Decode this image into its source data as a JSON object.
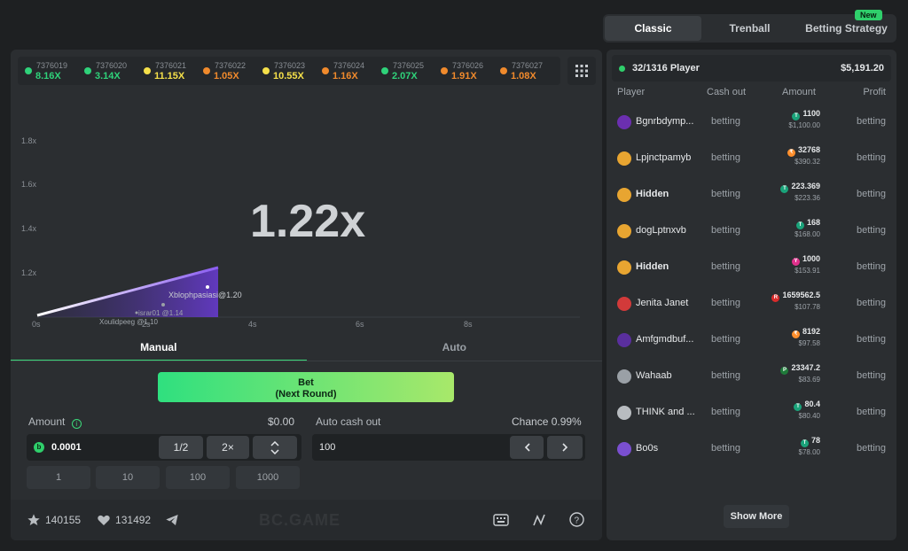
{
  "history": [
    {
      "id": "7376019",
      "mult": "8.16X",
      "color": "#2fd27a"
    },
    {
      "id": "7376020",
      "mult": "3.14X",
      "color": "#2fd27a"
    },
    {
      "id": "7376021",
      "mult": "11.15X",
      "color": "#f5e04a"
    },
    {
      "id": "7376022",
      "mult": "1.05X",
      "color": "#f08a2c"
    },
    {
      "id": "7376023",
      "mult": "10.55X",
      "color": "#f5e04a"
    },
    {
      "id": "7376024",
      "mult": "1.16X",
      "color": "#f08a2c"
    },
    {
      "id": "7376025",
      "mult": "2.07X",
      "color": "#2fd27a"
    },
    {
      "id": "7376026",
      "mult": "1.91X",
      "color": "#f08a2c"
    },
    {
      "id": "7376027",
      "mult": "1.08X",
      "color": "#f08a2c"
    }
  ],
  "game": {
    "multiplier": "1.22x",
    "y_ticks": [
      "1.8x",
      "1.6x",
      "1.4x",
      "1.2x"
    ],
    "x_ticks": [
      "0s",
      "4s",
      "6s",
      "8s"
    ],
    "x_tick_extra": "2s",
    "cashout_labels": [
      "Xblophpasiasi@1.20",
      "israr01 @1.14",
      "Xoulidpeeg @1.10"
    ]
  },
  "tabs": {
    "manual": "Manual",
    "auto": "Auto"
  },
  "bet_button": {
    "line1": "Bet",
    "line2": "(Next Round)"
  },
  "amount": {
    "label": "Amount",
    "usd": "$0.00",
    "value": "0.0001",
    "half": "1/2",
    "double": "2×",
    "quick": [
      "1",
      "10",
      "100",
      "1000"
    ]
  },
  "auto_cashout": {
    "label": "Auto cash out",
    "chance": "Chance 0.99%",
    "value": "100"
  },
  "footer": {
    "stars": "140155",
    "likes": "131492",
    "logo": "BC.GAME"
  },
  "top_tabs": {
    "classic": "Classic",
    "trenball": "Trenball",
    "strategy": "Betting Strategy",
    "new_badge": "New"
  },
  "players": {
    "count": "32/1316 Player",
    "total": "$5,191.20",
    "headers": {
      "player": "Player",
      "cashout": "Cash out",
      "amount": "Amount",
      "profit": "Profit"
    },
    "rows": [
      {
        "name": "Bgnrbdymp...",
        "bold": false,
        "cashout": "betting",
        "amount": "1100",
        "usd": "$1,100.00",
        "profit": "betting",
        "avatar": "#6b2fb0",
        "coin": "#1aa37a",
        "coin_glyph": "T"
      },
      {
        "name": "Lpjnctpamyb",
        "bold": false,
        "cashout": "betting",
        "amount": "32768",
        "usd": "$390.32",
        "profit": "betting",
        "avatar": "#e8a531",
        "coin": "#ff8f2c",
        "coin_glyph": "₹"
      },
      {
        "name": "Hidden",
        "bold": true,
        "cashout": "betting",
        "amount": "223.369",
        "usd": "$223.36",
        "profit": "betting",
        "avatar": "#e8a531",
        "coin": "#1aa37a",
        "coin_glyph": "T"
      },
      {
        "name": "dogLptnxvb",
        "bold": false,
        "cashout": "betting",
        "amount": "168",
        "usd": "$168.00",
        "profit": "betting",
        "avatar": "#e8a531",
        "coin": "#1aa37a",
        "coin_glyph": "T"
      },
      {
        "name": "Hidden",
        "bold": true,
        "cashout": "betting",
        "amount": "1000",
        "usd": "$153.91",
        "profit": "betting",
        "avatar": "#e8a531",
        "coin": "#e0308c",
        "coin_glyph": "Y"
      },
      {
        "name": "Jenita Janet",
        "bold": false,
        "cashout": "betting",
        "amount": "1659562.5",
        "usd": "$107.78",
        "profit": "betting",
        "avatar": "#d23a3a",
        "coin": "#d92b2b",
        "coin_glyph": "R"
      },
      {
        "name": "Amfgmdbuf...",
        "bold": false,
        "cashout": "betting",
        "amount": "8192",
        "usd": "$97.58",
        "profit": "betting",
        "avatar": "#5a2f9e",
        "coin": "#ff8f2c",
        "coin_glyph": "₹"
      },
      {
        "name": "Wahaab",
        "bold": false,
        "cashout": "betting",
        "amount": "23347.2",
        "usd": "$83.69",
        "profit": "betting",
        "avatar": "#9aa0a6",
        "coin": "#1f7a3a",
        "coin_glyph": "P"
      },
      {
        "name": "THINK and ...",
        "bold": false,
        "cashout": "betting",
        "amount": "80.4",
        "usd": "$80.40",
        "profit": "betting",
        "avatar": "#b8bcc0",
        "coin": "#1aa37a",
        "coin_glyph": "T"
      },
      {
        "name": "Bo0s",
        "bold": false,
        "cashout": "betting",
        "amount": "78",
        "usd": "$78.00",
        "profit": "betting",
        "avatar": "#7a4fd0",
        "coin": "#1aa37a",
        "coin_glyph": "T"
      }
    ],
    "show_more": "Show More"
  }
}
